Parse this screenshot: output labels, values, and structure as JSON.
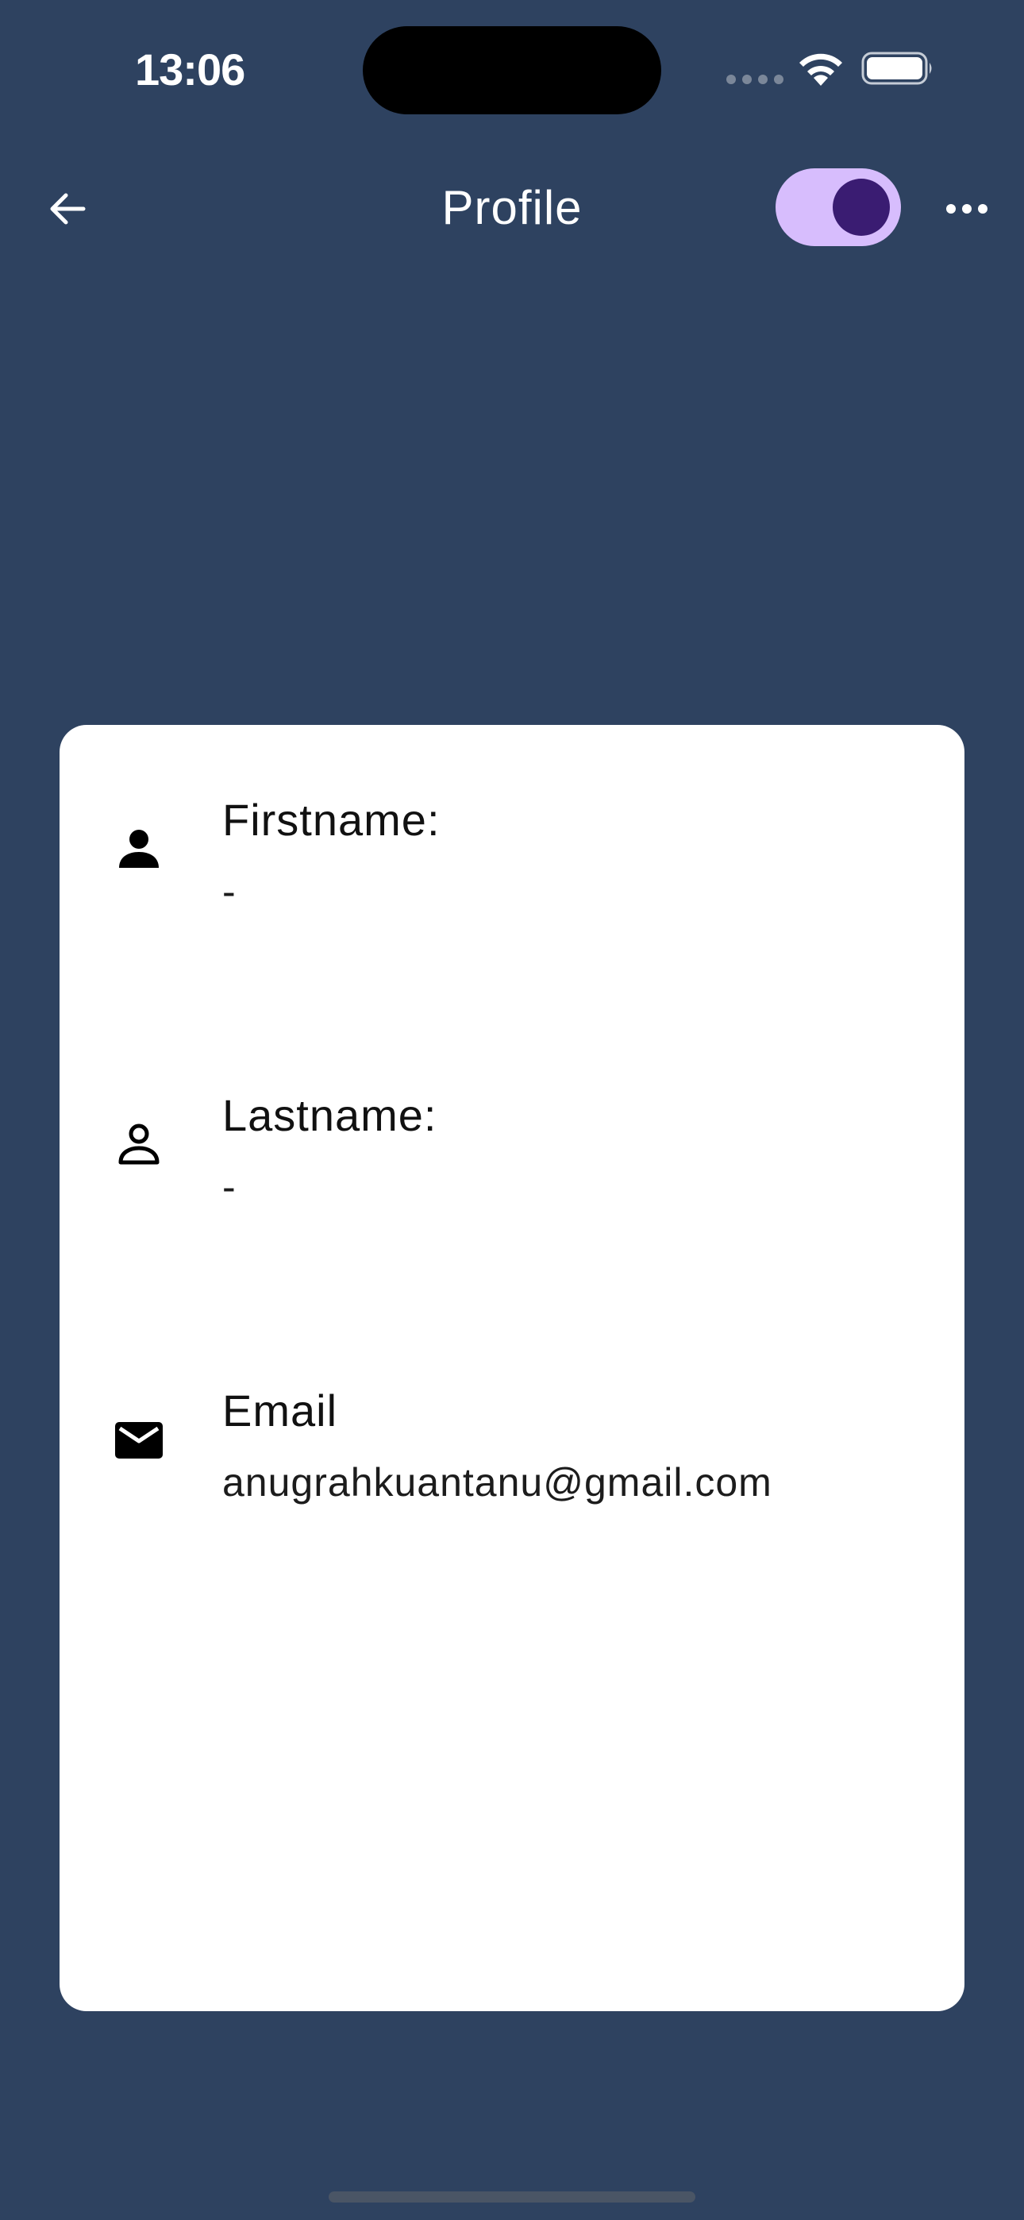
{
  "status_bar": {
    "time": "13:06"
  },
  "app_bar": {
    "title": "Profile",
    "back_icon": "arrow-left-icon",
    "more_icon": "more-horizontal-icon",
    "theme_toggle_on": true
  },
  "profile": {
    "fields": [
      {
        "icon": "person-filled-icon",
        "label": "Firstname:",
        "value": "-"
      },
      {
        "icon": "person-outline-icon",
        "label": "Lastname:",
        "value": "-"
      },
      {
        "icon": "mail-icon",
        "label": "Email",
        "value": "anugrahkuantanu@gmail.com"
      }
    ]
  },
  "colors": {
    "background": "#2e4260",
    "card": "#ffffff",
    "toggle_track": "#d7bdfd",
    "toggle_thumb": "#3a1c72"
  }
}
